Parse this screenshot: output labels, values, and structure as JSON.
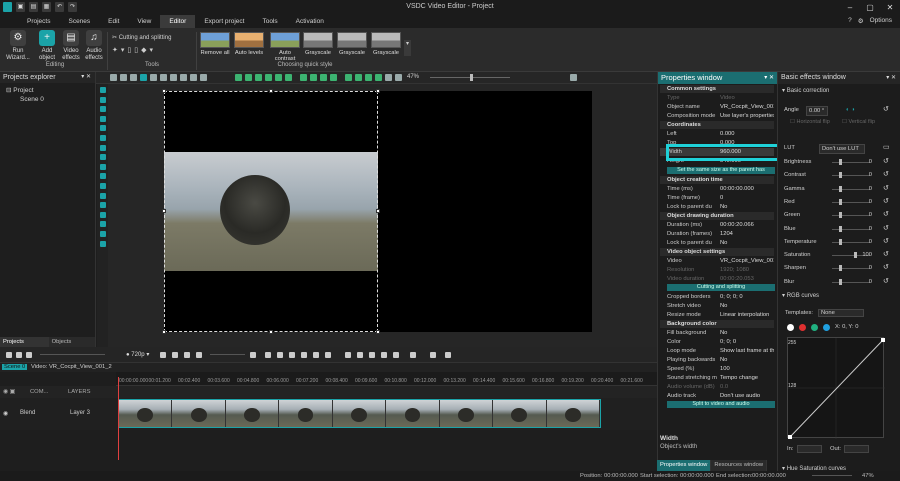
{
  "window": {
    "title": "VSDC Video Editor - Project",
    "options": "Options"
  },
  "menu": [
    "Projects",
    "Scenes",
    "Edit",
    "View",
    "Editor",
    "Export project",
    "Tools",
    "Activation"
  ],
  "menu_active": "Editor",
  "ribbon": {
    "run_wizard": "Run Wizard...",
    "add_object": "Add object",
    "video_effects": "Video effects",
    "audio_effects": "Audio effects",
    "editing_label": "Editing",
    "cutting": "Cutting and splitting",
    "tools_label": "Tools",
    "quick_styles": [
      "Remove all",
      "Auto levels",
      "Auto contrast",
      "Grayscale",
      "Grayscale",
      "Grayscale",
      "Grayscale"
    ],
    "quick_style_label": "Choosing quick style"
  },
  "toolstrip": {
    "zoom": "47%"
  },
  "projects_explorer": {
    "title": "Projects explorer",
    "project": "Project",
    "scene": "Scene 0"
  },
  "panel_tabs": [
    "Projects explorer",
    "Objects explorer"
  ],
  "timeline": {
    "resolution": "720p",
    "scene_tab": "Scene 0",
    "clip_tab": "Video: VR_Cocpit_View_001_2",
    "ticks": [
      "00:00:00.000",
      "00:01.200",
      "00:02.400",
      "00:03.600",
      "00:04.800",
      "00:06.000",
      "00:07.200",
      "00:08.400",
      "00:09.600",
      "00:10.800",
      "00:12.000",
      "00:13.200",
      "00:14.400",
      "00:15.600",
      "00:16.800",
      "00:19.200",
      "00:20.400",
      "00:21.600"
    ],
    "com_label": "COM...",
    "layers_label": "LAYERS",
    "blend_label": "Blend",
    "layer_name": "Layer 3"
  },
  "status": {
    "position_label": "Position:",
    "position": "00:00:00.000",
    "start_label": "Start selection:",
    "start": "00:00:00.000",
    "end_label": "End selection:",
    "end": "00:00:00.000",
    "zoom": "47%"
  },
  "properties": {
    "title": "Properties window",
    "common": "Common settings",
    "type_k": "Type",
    "type_v": "Video",
    "name_k": "Object name",
    "name_v": "VR_Cocpit_View_001_2",
    "comp_k": "Composition mode",
    "comp_v": "Use layer's properties",
    "coords": "Coordinates",
    "left_k": "Left",
    "left_v": "0.000",
    "top_k": "Top",
    "top_v": "0.000",
    "width_k": "Width",
    "width_v": "960.000",
    "height_k": "Height",
    "height_v": "540.000",
    "same_size": "Set the same size as the parent has",
    "creation": "Object creation time",
    "tms_k": "Time (ms)",
    "tms_v": "00:00:00.000",
    "tfr_k": "Time (frame)",
    "tfr_v": "0",
    "lock1_k": "Lock to parent du",
    "lock1_v": "No",
    "drawing": "Object drawing duration",
    "dms_k": "Duration (ms)",
    "dms_v": "00:00:20.066",
    "dfr_k": "Duration (frames)",
    "dfr_v": "1204",
    "lock2_k": "Lock to parent du",
    "lock2_v": "No",
    "vos": "Video object settings",
    "video_k": "Video",
    "video_v": "VR_Cocpit_View_001",
    "res_k": "Resolution",
    "res_v": "1920; 1080",
    "vdur_k": "Video duration",
    "vdur_v": "00:00:20.053",
    "cutting_btn": "Cutting and splitting",
    "crop_k": "Cropped borders",
    "crop_v": "0; 0; 0; 0",
    "stretch_k": "Stretch video",
    "stretch_v": "No",
    "resize_k": "Resize mode",
    "resize_v": "Linear interpolation",
    "bg": "Background color",
    "fill_k": "Fill background",
    "fill_v": "No",
    "color_k": "Color",
    "color_v": "0; 0; 0",
    "loop_k": "Loop mode",
    "loop_v": "Show last frame at the",
    "back_k": "Playing backwards",
    "back_v": "No",
    "speed_k": "Speed (%)",
    "speed_v": "100",
    "sound_k": "Sound stretching m",
    "sound_v": "Tempo change",
    "avol_k": "Audio volume (dB)",
    "avol_v": "0.0",
    "atrack_k": "Audio track",
    "atrack_v": "Don't use audio",
    "split_btn": "Split to video and audio",
    "desc_title": "Width",
    "desc_text": "Object's width"
  },
  "prop_tabs": [
    "Properties window",
    "Resources window"
  ],
  "effects": {
    "title": "Basic effects window",
    "basic": "Basic correction",
    "angle_k": "Angle",
    "angle_v": "0.00 °",
    "hflip": "Horizontal flip",
    "vflip": "Vertical flip",
    "lut_k": "LUT",
    "lut_v": "Don't use LUT",
    "sliders": [
      {
        "k": "Brightness",
        "v": "0"
      },
      {
        "k": "Contrast",
        "v": "0"
      },
      {
        "k": "Gamma",
        "v": "0"
      },
      {
        "k": "Red",
        "v": "0"
      },
      {
        "k": "Green",
        "v": "0"
      },
      {
        "k": "Blue",
        "v": "0"
      },
      {
        "k": "Temperature",
        "v": "0"
      },
      {
        "k": "Saturation",
        "v": "100"
      },
      {
        "k": "Sharpen",
        "v": "0"
      },
      {
        "k": "Blur",
        "v": "0"
      }
    ],
    "rgb": "RGB curves",
    "templates_k": "Templates:",
    "templates_v": "None",
    "xy": "X: 0, Y: 0",
    "c255": "255",
    "c128": "128",
    "in_k": "In:",
    "out_k": "Out:",
    "hue": "Hue Saturation curves"
  }
}
